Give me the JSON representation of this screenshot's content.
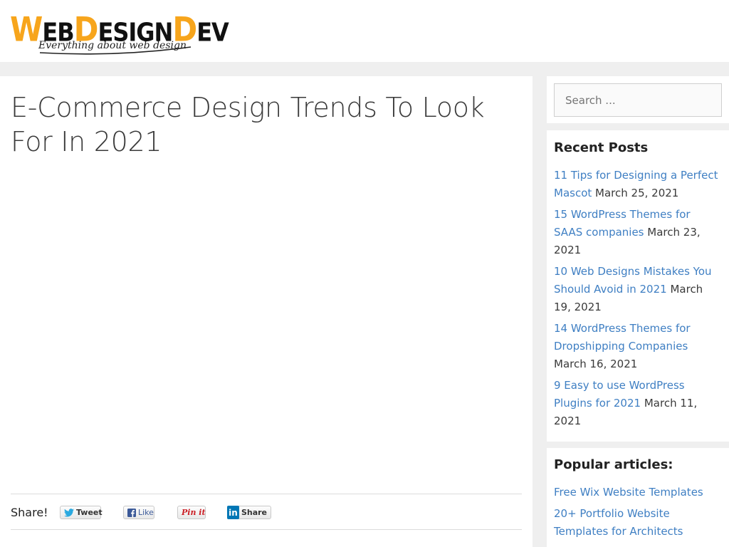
{
  "site": {
    "logo_w": "W",
    "logo_eb": "EB",
    "logo_d": "D",
    "logo_esign": "ESIGN",
    "logo_d2": "D",
    "logo_ev": "EV",
    "tagline": "Everything about web design"
  },
  "post": {
    "title": "E-Commerce Design Trends To Look For In 2021"
  },
  "share": {
    "label": "Share!",
    "tweet": "Tweet",
    "like": "Like",
    "pin": "Pin it",
    "share": "Share"
  },
  "search": {
    "placeholder": "Search ..."
  },
  "recent": {
    "title": "Recent Posts",
    "items": [
      {
        "link": "11 Tips for Designing a Perfect Mascot",
        "date": "March 25, 2021"
      },
      {
        "link": "15 WordPress Themes for SAAS companies",
        "date": "March 23, 2021"
      },
      {
        "link": "10 Web Designs Mistakes You Should Avoid in 2021",
        "date": "March 19, 2021"
      },
      {
        "link": "14 WordPress Themes for Dropshipping Companies",
        "date": "March 16, 2021"
      },
      {
        "link": "9 Easy to use WordPress Plugins for 2021",
        "date": "March 11, 2021"
      }
    ]
  },
  "popular": {
    "title": "Popular articles:",
    "items": [
      {
        "link": "Free Wix Website Templates"
      },
      {
        "link": "20+ Portfolio Website Templates for Architects"
      }
    ]
  },
  "colors": {
    "link": "#3f7fc3",
    "logo_orange": "#f7a51c",
    "page_bg": "#efefef"
  }
}
